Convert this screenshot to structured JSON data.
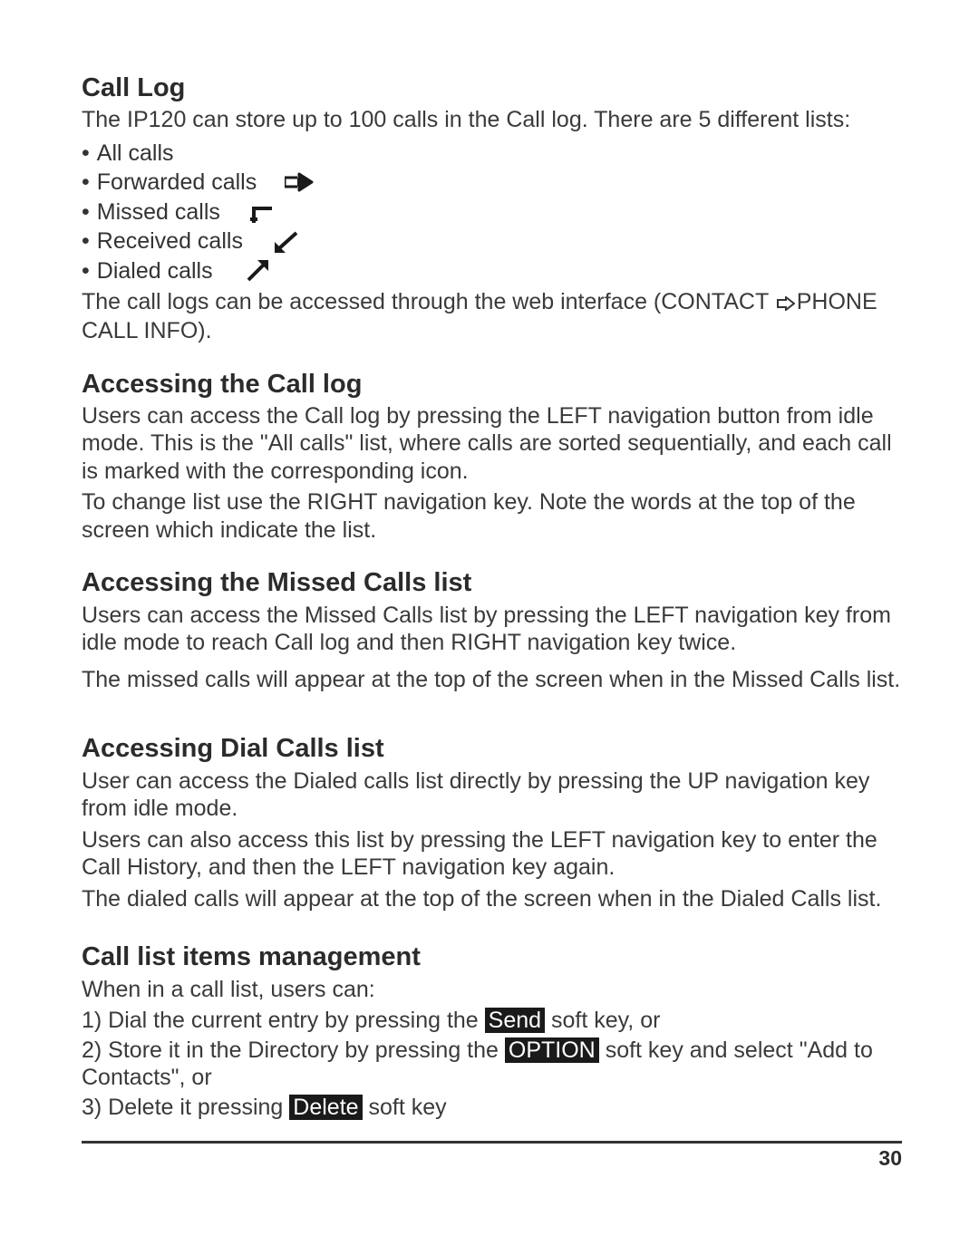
{
  "sections": {
    "callLog": {
      "heading": "Call Log",
      "intro": "The IP120 can store up to 100 calls in the Call log. There are 5 different lists:",
      "items": [
        {
          "label": "All calls",
          "icon": null
        },
        {
          "label": "Forwarded calls",
          "icon": "forwarded-icon"
        },
        {
          "label": "Missed calls",
          "icon": "missed-icon"
        },
        {
          "label": "Received calls",
          "icon": "received-icon"
        },
        {
          "label": "Dialed calls",
          "icon": "dialed-icon"
        }
      ],
      "webAccess": {
        "pre": "The call logs can be accessed through the web interface (CONTACT ",
        "post": "PHONE CALL INFO)."
      }
    },
    "accessCallLog": {
      "heading": "Accessing the Call log",
      "p1": "Users can access the Call log by pressing the LEFT navigation button from idle mode. This is the \"All calls\" list, where calls are sorted sequentially, and each call is marked with the corresponding icon.",
      "p2": "To change list use the RIGHT navigation key. Note the words at the top of the screen which indicate the list."
    },
    "accessMissed": {
      "heading": "Accessing the Missed Calls list",
      "p1": "Users can access the Missed Calls list by pressing the LEFT navigation key from idle mode to reach Call log and then RIGHT navigation key twice.",
      "p2": "The missed calls will appear at the top of the screen when in the Missed Calls list."
    },
    "accessDial": {
      "heading": "Accessing Dial Calls list",
      "p1": "User can access the Dialed calls list directly by pressing the UP navigation key from idle mode.",
      "p2": "Users can also access this list by pressing the LEFT navigation key to enter the Call History, and then the LEFT navigation key again.",
      "p3": "The dialed calls will appear at the top of the screen when in the Dialed Calls list."
    },
    "mgmt": {
      "heading": "Call list items management",
      "intro": "When in a call list, users can:",
      "item1": {
        "pre": "1) Dial the current entry by pressing the",
        "key": "Send",
        "post": "soft key, or"
      },
      "item2": {
        "pre": "2) Store it in the Directory by pressing the",
        "key": "OPTION",
        "post": "soft key and select \"Add to Contacts\", or"
      },
      "item3": {
        "pre": "3) Delete it pressing",
        "key": "Delete",
        "post": "soft key"
      }
    }
  },
  "pageNumber": "30"
}
